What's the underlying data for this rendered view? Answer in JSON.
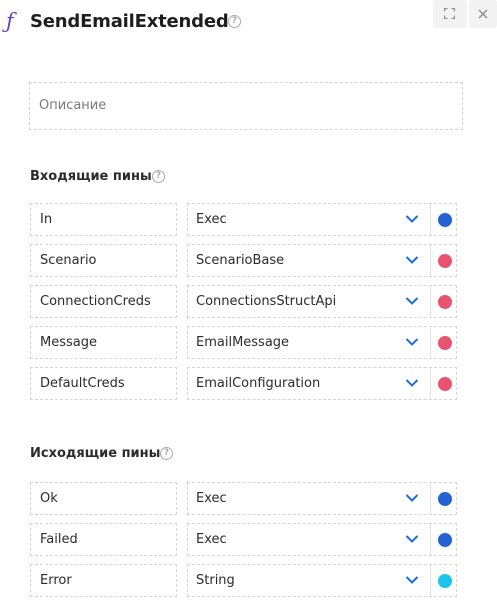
{
  "header": {
    "title": "SendEmailExtended",
    "icon": "function-icon"
  },
  "description": {
    "placeholder": "Описание"
  },
  "incoming": {
    "title": "Входящие пины",
    "pins": [
      {
        "name": "In",
        "type": "Exec",
        "color": "#2563d4"
      },
      {
        "name": "Scenario",
        "type": "ScenarioBase",
        "color": "#e8536f"
      },
      {
        "name": "ConnectionCreds",
        "type": "ConnectionsStructApi",
        "color": "#e8536f"
      },
      {
        "name": "Message",
        "type": "EmailMessage",
        "color": "#e8536f"
      },
      {
        "name": "DefaultCreds",
        "type": "EmailConfiguration",
        "color": "#e8536f"
      }
    ]
  },
  "outgoing": {
    "title": "Исходящие пины",
    "pins": [
      {
        "name": "Ok",
        "type": "Exec",
        "color": "#2563d4"
      },
      {
        "name": "Failed",
        "type": "Exec",
        "color": "#2563d4"
      },
      {
        "name": "Error",
        "type": "String",
        "color": "#1cc3ea"
      }
    ]
  }
}
